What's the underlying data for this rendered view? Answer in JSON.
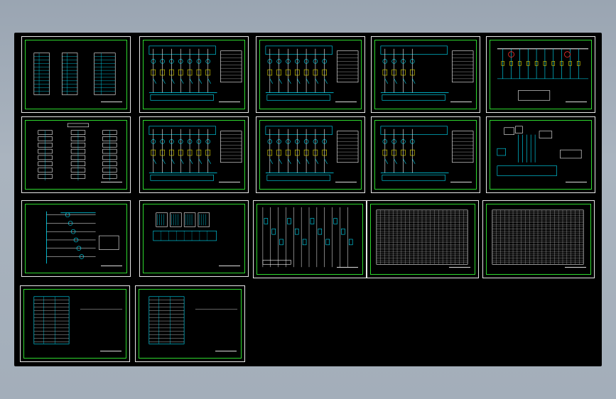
{
  "colors": {
    "background": "#a3aeba",
    "canvas": "#000000",
    "sheet_border": "#e8e8e8",
    "frame": "#2ed82e",
    "cyan": "#00e5ff",
    "white": "#ffffff",
    "yellow": "#e8e000",
    "red": "#ff3030"
  },
  "sheets": [
    {
      "kind": "table"
    },
    {
      "kind": "schematic"
    },
    {
      "kind": "schematic"
    },
    {
      "kind": "schematic-small"
    },
    {
      "kind": "busbar"
    },
    {
      "kind": "flowchart"
    },
    {
      "kind": "schematic"
    },
    {
      "kind": "schematic"
    },
    {
      "kind": "schematic-small"
    },
    {
      "kind": "devices"
    },
    {
      "kind": "ladder"
    },
    {
      "kind": "terminals"
    },
    {
      "kind": "wiring"
    },
    {
      "kind": "grid"
    },
    {
      "kind": "grid"
    },
    {
      "kind": "list"
    },
    {
      "kind": "list"
    }
  ]
}
